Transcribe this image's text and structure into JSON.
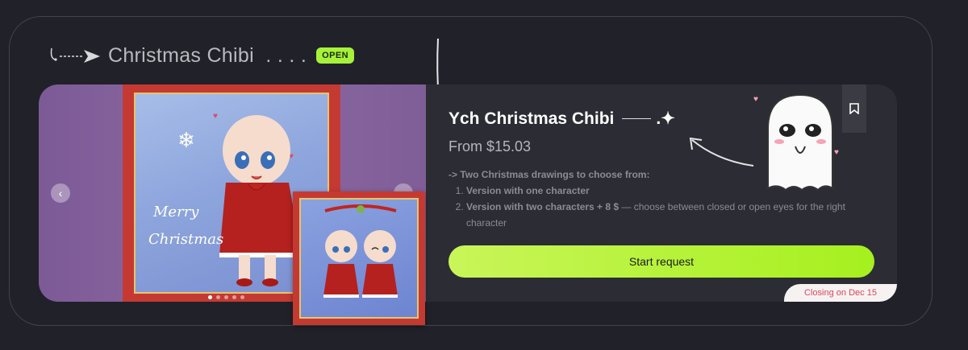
{
  "section": {
    "title": "Christmas Chibi  . . . .",
    "badge": "OPEN"
  },
  "gallery": {
    "slide_count": 5,
    "active_index": 0,
    "prev_icon": "chevron-left-icon",
    "next_icon": "chevron-right-icon"
  },
  "artwork_main": {
    "text": "Merry\nChristmas"
  },
  "product": {
    "title": "Ych Christmas Chibi",
    "title_suffix": ".✦",
    "price": "From $15.03",
    "intro": "-> Two Christmas drawings to choose from:",
    "options": [
      {
        "bold": "Version with one character",
        "rest": ""
      },
      {
        "bold": "Version with two characters + 8 $",
        "rest": " — choose between closed or open eyes for the right character"
      }
    ],
    "cta_label": "Start request",
    "closing": "Closing on Dec 15"
  },
  "colors": {
    "accent": "#a6f01e",
    "background": "#212129",
    "card": "#2c2c35",
    "closing_text": "#e0465c"
  }
}
